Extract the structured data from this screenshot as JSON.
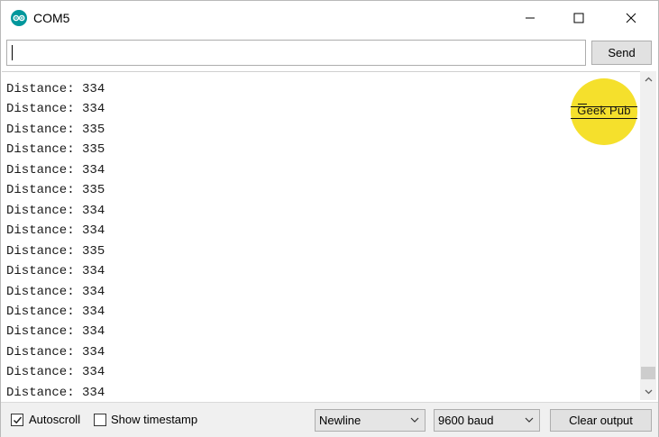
{
  "window": {
    "title": "COM5"
  },
  "input": {
    "value": "",
    "send_label": "Send"
  },
  "output": {
    "lines": [
      "Distance: 334",
      "Distance: 334",
      "Distance: 335",
      "Distance: 335",
      "Distance: 334",
      "Distance: 335",
      "Distance: 334",
      "Distance: 334",
      "Distance: 335",
      "Distance: 334",
      "Distance: 334",
      "Distance: 334",
      "Distance: 334",
      "Distance: 334",
      "Distance: 334",
      "Distance: 334"
    ]
  },
  "logo": {
    "text": "Geek Pub",
    "color": "#f5e02c"
  },
  "bottombar": {
    "autoscroll_label": "Autoscroll",
    "autoscroll_checked": true,
    "timestamp_label": "Show timestamp",
    "timestamp_checked": false,
    "line_ending": "Newline",
    "baud_rate": "9600 baud",
    "clear_label": "Clear output"
  },
  "colors": {
    "app_icon": "#00979c",
    "button_bg": "#e1e1e1",
    "bar_bg": "#f0f0f0"
  }
}
